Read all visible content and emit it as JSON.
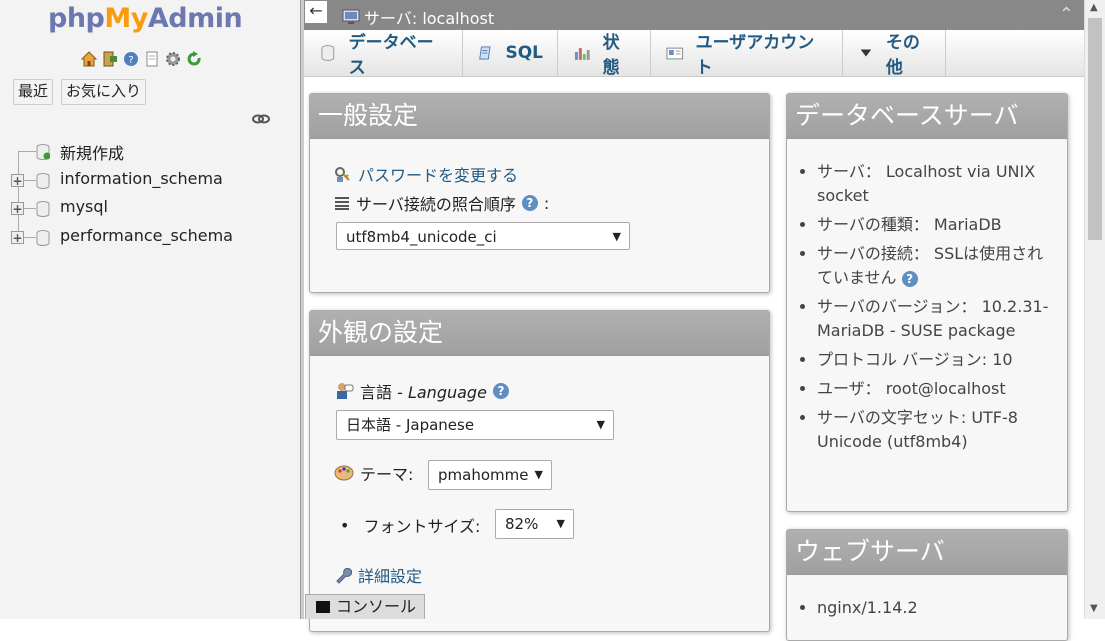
{
  "logo": {
    "php": "php",
    "my": "My",
    "admin": "Admin"
  },
  "nav": {
    "buttons": {
      "recent": "最近",
      "favorites": "お気に入り"
    },
    "tree": [
      {
        "label": "新規作成",
        "kind": "new"
      },
      {
        "label": "information_schema",
        "kind": "db"
      },
      {
        "label": "mysql",
        "kind": "db"
      },
      {
        "label": "performance_schema",
        "kind": "db"
      }
    ]
  },
  "topbar": {
    "collapse": "←",
    "crumb": "サーバ: localhost",
    "up": "⌃"
  },
  "tabs": [
    {
      "label": "データベース",
      "icon": "database-icon"
    },
    {
      "label": "SQL",
      "icon": "sql-icon"
    },
    {
      "label": "状態",
      "icon": "status-icon"
    },
    {
      "label": "ユーザアカウント",
      "icon": "user-accounts-icon"
    },
    {
      "label": "その他",
      "icon": "triangle-down-icon"
    }
  ],
  "general": {
    "title": "一般設定",
    "change_password": "パスワードを変更する",
    "collation_label": "サーバ接続の照合順序",
    "collation_colon": ":",
    "collation_value": "utf8mb4_unicode_ci"
  },
  "appearance": {
    "title": "外観の設定",
    "language_label": "言語 - ",
    "language_label_en": "Language",
    "language_value": "日本語 - Japanese",
    "theme_label": "テーマ:",
    "theme_value": "pmahomme",
    "fontsize_label": "フォントサイズ:",
    "fontsize_value": "82%",
    "more_settings": "詳細設定"
  },
  "dbserver": {
    "title": "データベースサーバ",
    "items": [
      "サーバ： Localhost via UNIX socket",
      "サーバの種類： MariaDB",
      "サーバの接続： SSLは使用されていません",
      "サーバのバージョン： 10.2.31-MariaDB - SUSE package",
      "プロトコル バージョン: 10",
      "ユーザ： root@localhost",
      "サーバの文字セット: UTF-8 Unicode (utf8mb4)"
    ]
  },
  "webserver": {
    "title": "ウェブサーバ",
    "items": [
      "nginx/1.14.2"
    ]
  },
  "console": {
    "label": "コンソール"
  },
  "colors": {
    "link": "#235a81",
    "panel_head": "#a8a8a8",
    "topbar": "#888888"
  }
}
